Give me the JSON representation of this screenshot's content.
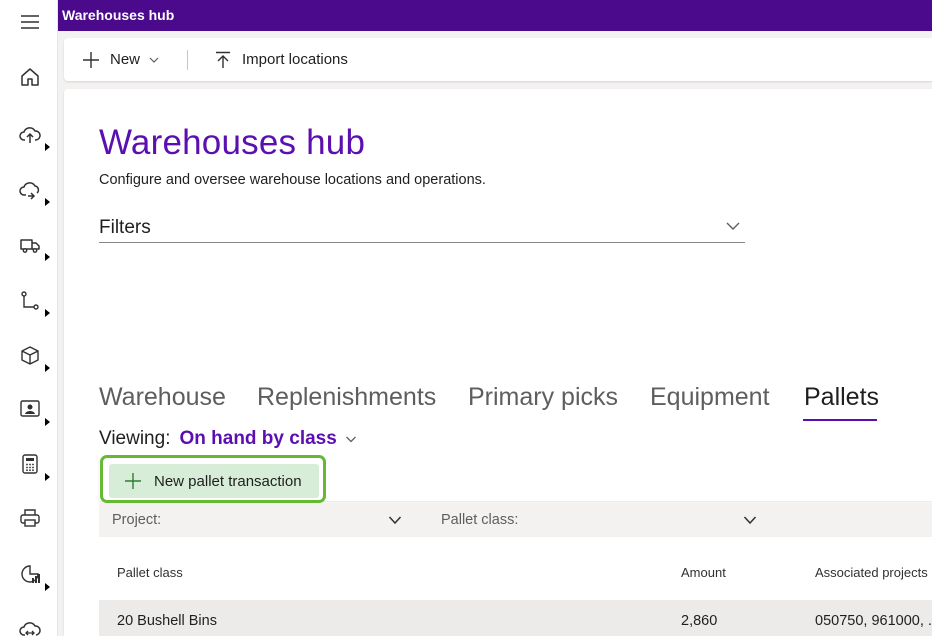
{
  "app": {
    "title": "Warehouses hub"
  },
  "rail": {
    "items": [
      {
        "icon": "menu-icon"
      },
      {
        "icon": "home-icon"
      },
      {
        "icon": "cloud-upload-icon"
      },
      {
        "icon": "cloud-sync-icon"
      },
      {
        "icon": "truck-icon"
      },
      {
        "icon": "flow-icon"
      },
      {
        "icon": "box-icon"
      },
      {
        "icon": "contact-card-icon"
      },
      {
        "icon": "calculator-icon"
      },
      {
        "icon": "print-icon"
      },
      {
        "icon": "analytics-icon"
      },
      {
        "icon": "cloud-transfer-icon"
      }
    ]
  },
  "commandbar": {
    "new_label": "New",
    "import_label": "Import locations"
  },
  "page": {
    "title": "Warehouses hub",
    "subtitle": "Configure and oversee warehouse locations and operations.",
    "filters_label": "Filters"
  },
  "tabs": [
    {
      "label": "Warehouse",
      "active": false
    },
    {
      "label": "Replenishments",
      "active": false
    },
    {
      "label": "Primary picks",
      "active": false
    },
    {
      "label": "Equipment",
      "active": false
    },
    {
      "label": "Pallets",
      "active": true
    }
  ],
  "viewing": {
    "label": "Viewing:",
    "value": "On hand by class"
  },
  "subbar": {
    "new_pallet_label": "New pallet transaction"
  },
  "grid_filters": {
    "project_label": "Project:",
    "pallet_class_label": "Pallet class:"
  },
  "grid": {
    "columns": [
      "Pallet class",
      "Amount",
      "Associated projects"
    ],
    "rows": [
      {
        "pallet_class": "20 Bushell Bins",
        "amount": "2,860",
        "projects": "050750, 961000, ..."
      }
    ]
  },
  "colors": {
    "brand": "#4b0a8c",
    "accent": "#5c0fb0",
    "highlight_outline": "#66b933",
    "highlight_fill": "#d7edd8"
  }
}
